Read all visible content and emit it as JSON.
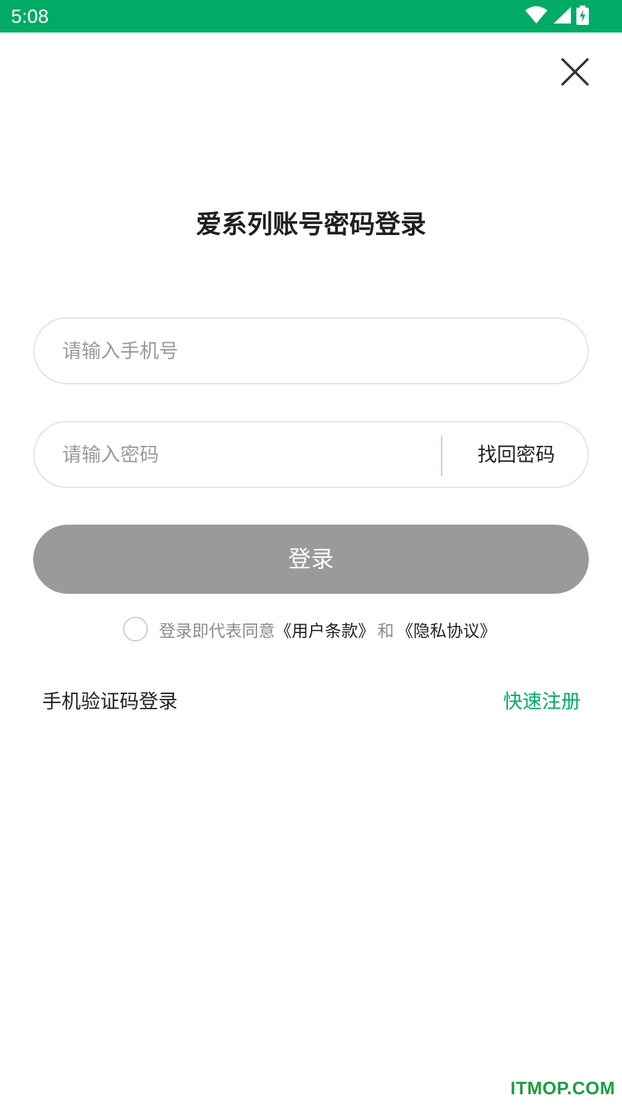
{
  "status_bar": {
    "time": "5:08",
    "icons": [
      "wifi-icon",
      "cellular-signal-icon",
      "battery-charging-icon"
    ],
    "background": "#00ab66"
  },
  "header": {
    "close_icon": "close-icon"
  },
  "title": "爱系列账号密码登录",
  "phone_input": {
    "placeholder": "请输入手机号",
    "value": ""
  },
  "password_input": {
    "placeholder": "请输入密码",
    "value": "",
    "forgot_label": "找回密码"
  },
  "login_button": {
    "label": "登录",
    "color": "#9a9a9a"
  },
  "agreement": {
    "prefix": "登录即代表同意",
    "terms_link": "《用户条款》",
    "and": "和",
    "privacy_link": "《隐私协议》",
    "checked": false
  },
  "footer_links": {
    "sms_login": "手机验证码登录",
    "register": "快速注册",
    "register_color": "#00ab66"
  },
  "watermark": "ITMOP.COM"
}
